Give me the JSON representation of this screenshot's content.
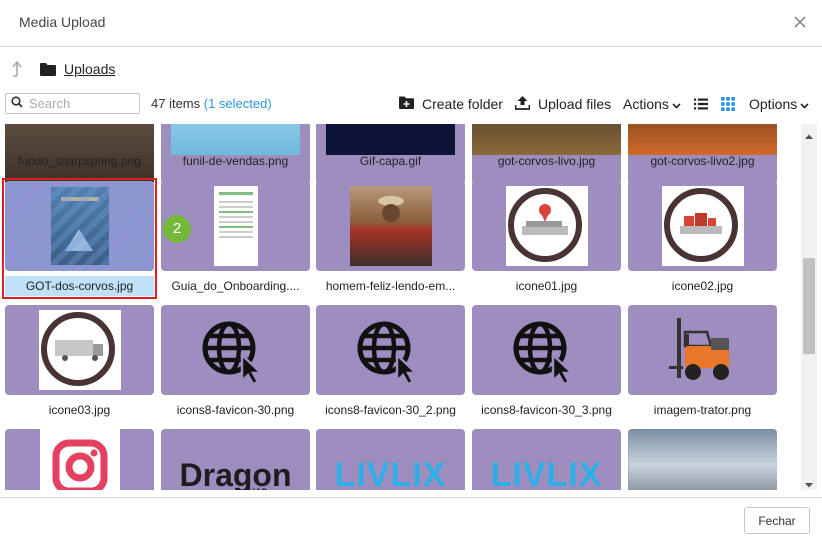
{
  "dialog": {
    "title": "Media Upload"
  },
  "breadcrumb": {
    "folder": "Uploads"
  },
  "toolbar": {
    "search_placeholder": "Search",
    "items_count": "47 items",
    "selected_count": "(1 selected)",
    "create_folder": "Create folder",
    "upload_files": "Upload files",
    "actions": "Actions",
    "options": "Options"
  },
  "files": [
    {
      "name": "fundo_sharpspring.png",
      "thumb": "photo-desk"
    },
    {
      "name": "funil-de-vendas.png",
      "thumb": "graphic-blue"
    },
    {
      "name": "Gif-capa.gif",
      "thumb": "dark-navy"
    },
    {
      "name": "got-corvos-livo.jpg",
      "thumb": "photo-brown"
    },
    {
      "name": "got-corvos-livo2.jpg",
      "thumb": "photo-orange"
    },
    {
      "name": "GOT-dos-corvos.jpg",
      "thumb": "book-cover",
      "selected": true
    },
    {
      "name": "Guia_do_Onboarding....",
      "thumb": "document"
    },
    {
      "name": "homem-feliz-lendo-em...",
      "thumb": "photo-man"
    },
    {
      "name": "icone01.jpg",
      "thumb": "circle-icon-ship"
    },
    {
      "name": "icone02.jpg",
      "thumb": "circle-icon-red"
    },
    {
      "name": "icone03.jpg",
      "thumb": "circle-icon-truck"
    },
    {
      "name": "icons8-favicon-30.png",
      "thumb": "globe-cursor-icon"
    },
    {
      "name": "icons8-favicon-30_2.png",
      "thumb": "globe-cursor-icon"
    },
    {
      "name": "icons8-favicon-30_3.png",
      "thumb": "globe-cursor-icon"
    },
    {
      "name": "imagem-trator.png",
      "thumb": "forklift"
    },
    {
      "name": "",
      "thumb": "instagram-icon"
    },
    {
      "name": "",
      "thumb": "logo-text",
      "logo_text": "Dragon",
      "logo_sub": "SQUAD"
    },
    {
      "name": "",
      "thumb": "logo-text",
      "logo_text": "LIVLIX"
    },
    {
      "name": "",
      "thumb": "logo-text",
      "logo_text": "LIVLIX"
    },
    {
      "name": "",
      "thumb": "photo-office"
    }
  ],
  "badge": {
    "text": "2"
  },
  "footer": {
    "close_label": "Fechar"
  },
  "colors": {
    "tile_bg": "#9e8dbf",
    "selection_blue": "#bfe2f8",
    "selection_frame": "#e01e1e",
    "badge_green": "#76b83a",
    "accent_blue": "#2a97dd"
  }
}
